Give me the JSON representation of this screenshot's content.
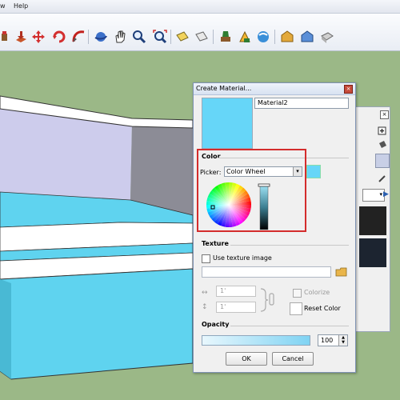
{
  "menu": {
    "items": [
      "w",
      "Help"
    ]
  },
  "toolbar": {
    "icons": [
      "materials-icon",
      "extrude-icon",
      "move-icon",
      "rotate-icon",
      "follow-me-icon",
      "orbit-icon",
      "pan-icon",
      "zoom-icon",
      "zoom-extents-icon",
      "paint-icon",
      "section-icon",
      "walk-icon",
      "position-camera-icon",
      "look-around-icon",
      "share-model-icon",
      "get-models-icon",
      "photo-textures-icon",
      "component-icon"
    ]
  },
  "dialog": {
    "title": "Create Material...",
    "close_glyph": "×",
    "material_name": "Material2",
    "preview_color": "#66d6f8",
    "color": {
      "section_label": "Color",
      "picker_label": "Picker:",
      "picker_value": "Color Wheel",
      "swatch_color": "#66d6f8",
      "highlight_color": "#d42c2c"
    },
    "texture": {
      "section_label": "Texture",
      "use_texture_label": "Use texture image",
      "width_value": "1'",
      "height_value": "1'",
      "colorize_label": "Colorize",
      "reset_color_label": "Reset Color"
    },
    "opacity": {
      "section_label": "Opacity",
      "value": "100",
      "level": 1.0
    },
    "ok_label": "OK",
    "cancel_label": "Cancel"
  },
  "model": {
    "face_colors": {
      "cyan": "#5fd3ef",
      "lavender": "#cdccec",
      "white": "#ffffff",
      "grey": "#8c8c96"
    }
  }
}
